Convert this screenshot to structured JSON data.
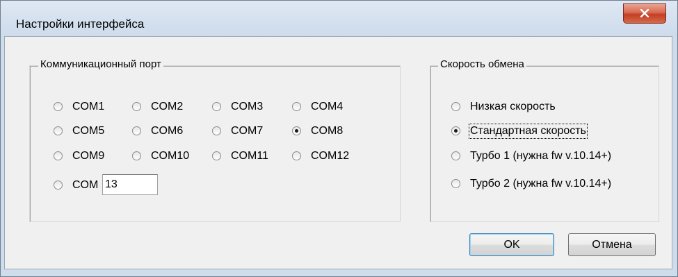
{
  "window": {
    "title": "Настройки интерфейса"
  },
  "port_group": {
    "title": "Коммуникационный порт",
    "options": [
      "COM1",
      "COM2",
      "COM3",
      "COM4",
      "COM5",
      "COM6",
      "COM7",
      "COM8",
      "COM9",
      "COM10",
      "COM11",
      "COM12",
      "COM"
    ],
    "selected": "COM8",
    "custom_value": "13"
  },
  "speed_group": {
    "title": "Скорость обмена",
    "options": [
      "Низкая скорость",
      "Стандартная скорость",
      "Турбо 1 (нужна fw v.10.14+)",
      "Турбо 2 (нужна fw v.10.14+)"
    ],
    "selected": "Стандартная скорость"
  },
  "buttons": {
    "ok": "OK",
    "cancel": "Отмена"
  },
  "icons": {
    "close": "close-icon"
  },
  "colors": {
    "close_button": "#c33f25",
    "title_bar": "#dfe8f3",
    "dialog_bg": "#f0f0f0"
  }
}
